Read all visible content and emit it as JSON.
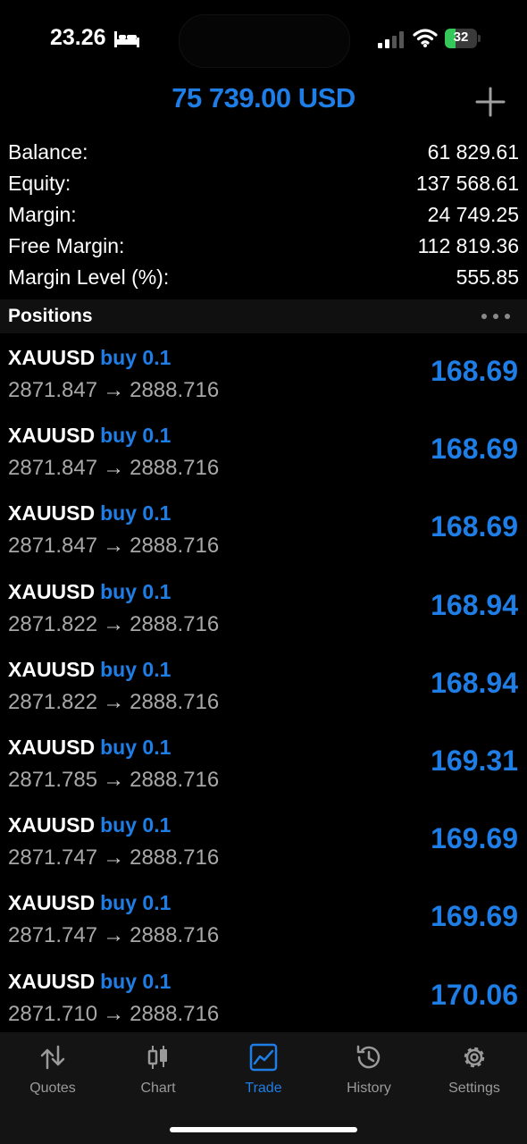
{
  "status_bar": {
    "time": "23.26",
    "battery": "32",
    "battery_level": 0.32,
    "icons": [
      "bed-icon",
      "cellular-signal-icon",
      "wifi-icon",
      "battery-icon"
    ]
  },
  "header": {
    "total": "75 739.00 USD",
    "add_icon": "plus-icon"
  },
  "account": [
    {
      "label": "Balance:",
      "value": "61 829.61"
    },
    {
      "label": "Equity:",
      "value": "137 568.61"
    },
    {
      "label": "Margin:",
      "value": "24 749.25"
    },
    {
      "label": "Free Margin:",
      "value": "112 819.36"
    },
    {
      "label": "Margin Level (%):",
      "value": "555.85"
    }
  ],
  "positions": {
    "title": "Positions",
    "more_icon": "more-dots-icon",
    "items": [
      {
        "symbol": "XAUUSD",
        "side": "buy 0.1",
        "open": "2871.847",
        "arrow": "→",
        "current": "2888.716",
        "profit": "168.69"
      },
      {
        "symbol": "XAUUSD",
        "side": "buy 0.1",
        "open": "2871.847",
        "arrow": "→",
        "current": "2888.716",
        "profit": "168.69"
      },
      {
        "symbol": "XAUUSD",
        "side": "buy 0.1",
        "open": "2871.847",
        "arrow": "→",
        "current": "2888.716",
        "profit": "168.69"
      },
      {
        "symbol": "XAUUSD",
        "side": "buy 0.1",
        "open": "2871.822",
        "arrow": "→",
        "current": "2888.716",
        "profit": "168.94"
      },
      {
        "symbol": "XAUUSD",
        "side": "buy 0.1",
        "open": "2871.822",
        "arrow": "→",
        "current": "2888.716",
        "profit": "168.94"
      },
      {
        "symbol": "XAUUSD",
        "side": "buy 0.1",
        "open": "2871.785",
        "arrow": "→",
        "current": "2888.716",
        "profit": "169.31"
      },
      {
        "symbol": "XAUUSD",
        "side": "buy 0.1",
        "open": "2871.747",
        "arrow": "→",
        "current": "2888.716",
        "profit": "169.69"
      },
      {
        "symbol": "XAUUSD",
        "side": "buy 0.1",
        "open": "2871.747",
        "arrow": "→",
        "current": "2888.716",
        "profit": "169.69"
      },
      {
        "symbol": "XAUUSD",
        "side": "buy 0.1",
        "open": "2871.710",
        "arrow": "→",
        "current": "2888.716",
        "profit": "170.06"
      }
    ]
  },
  "tabs": [
    {
      "label": "Quotes",
      "icon": "quotes-arrows-icon",
      "active": false
    },
    {
      "label": "Chart",
      "icon": "candlestick-icon",
      "active": false
    },
    {
      "label": "Trade",
      "icon": "trade-chart-icon",
      "active": true
    },
    {
      "label": "History",
      "icon": "history-clock-icon",
      "active": false
    },
    {
      "label": "Settings",
      "icon": "gear-icon",
      "active": false
    }
  ],
  "colors": {
    "accent": "#1e7ee6",
    "background": "#000000",
    "muted_text": "#a8a8a8",
    "battery_green": "#34c759"
  }
}
